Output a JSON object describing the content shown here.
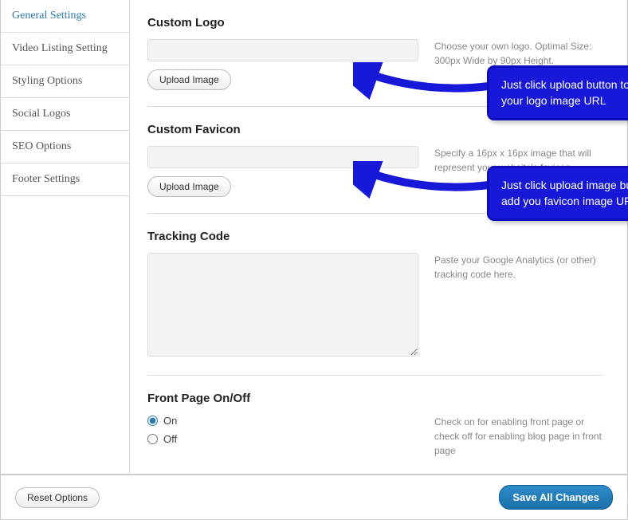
{
  "sidebar": {
    "items": [
      {
        "label": "General Settings",
        "active": true
      },
      {
        "label": "Video Listing Setting",
        "active": false
      },
      {
        "label": "Styling Options",
        "active": false
      },
      {
        "label": "Social Logos",
        "active": false
      },
      {
        "label": "SEO Options",
        "active": false
      },
      {
        "label": "Footer Settings",
        "active": false
      }
    ]
  },
  "sections": {
    "logo": {
      "title": "Custom Logo",
      "help": "Choose your own logo. Optimal Size: 300px Wide by 90px Height.",
      "button": "Upload Image",
      "value": ""
    },
    "favicon": {
      "title": "Custom Favicon",
      "help": "Specify a 16px x 16px image that will represent your website's favicon.",
      "button": "Upload Image",
      "value": ""
    },
    "tracking": {
      "title": "Tracking Code",
      "help": "Paste your Google Analytics (or other) tracking code here.",
      "value": ""
    },
    "frontpage": {
      "title": "Front Page On/Off",
      "help": "Check on for enabling front page or check off for enabling blog page in front page",
      "on_label": "On",
      "off_label": "Off",
      "value": "on"
    }
  },
  "callouts": {
    "logo": "Just click upload button to add your logo image URL",
    "favicon": "Just click upload image button to add you favicon image URL"
  },
  "footer": {
    "reset": "Reset Options",
    "save": "Save All Changes"
  }
}
